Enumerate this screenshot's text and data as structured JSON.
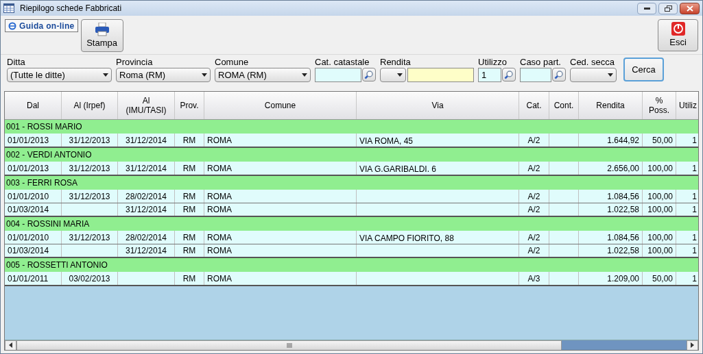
{
  "window": {
    "title": "Riepilogo schede Fabbricati"
  },
  "toolbar": {
    "help_link": "Guida on-line",
    "print_button": "Stampa",
    "exit_button": "Esci"
  },
  "filters": [
    {
      "kind": "select",
      "label": "Ditta",
      "value": "(Tutte le ditte)"
    },
    {
      "kind": "select",
      "label": "Provincia",
      "value": "Roma (RM)"
    },
    {
      "kind": "select",
      "label": "Comune",
      "value": "ROMA (RM)"
    },
    {
      "kind": "lookup",
      "label": "Cat. catastale"
    },
    {
      "kind": "range",
      "label": "Rendita"
    },
    {
      "kind": "lookup",
      "label": "Utilizzo",
      "value": "1"
    },
    {
      "kind": "lookup",
      "label": "Caso part."
    },
    {
      "kind": "select",
      "label": "Ced. secca"
    }
  ],
  "search_button": "Cerca",
  "table": {
    "columns": [
      "Dal",
      "Al (Irpef)",
      "Al (IMU/TASI)",
      "Prov.",
      "Comune",
      "Via",
      "Cat.",
      "Cont.",
      "Rendita",
      "% Poss.",
      "Utiliz"
    ],
    "groups": [
      {
        "title": "001 - ROSSI MARIO",
        "rows": [
          [
            "01/01/2013",
            "31/12/2013",
            "31/12/2014",
            "RM",
            "ROMA",
            "VIA ROMA, 45",
            "A/2",
            "",
            "1.644,92",
            "50,00",
            "1"
          ]
        ]
      },
      {
        "title": "002 - VERDI ANTONIO",
        "rows": [
          [
            "01/01/2013",
            "31/12/2013",
            "31/12/2014",
            "RM",
            "ROMA",
            "VIA G.GARIBALDI. 6",
            "A/2",
            "",
            "2.656,00",
            "100,00",
            "1"
          ]
        ]
      },
      {
        "title": "003 - FERRI ROSA",
        "rows": [
          [
            "01/01/2010",
            "31/12/2013",
            "28/02/2014",
            "RM",
            "ROMA",
            "",
            "A/2",
            "",
            "1.084,56",
            "100,00",
            "1"
          ],
          [
            "01/03/2014",
            "",
            "31/12/2014",
            "RM",
            "ROMA",
            "",
            "A/2",
            "",
            "1.022,58",
            "100,00",
            "1"
          ]
        ]
      },
      {
        "title": "004 - ROSSINI MARIA",
        "rows": [
          [
            "01/01/2010",
            "31/12/2013",
            "28/02/2014",
            "RM",
            "ROMA",
            "VIA CAMPO FIORITO, 88",
            "A/2",
            "",
            "1.084,56",
            "100,00",
            "1"
          ],
          [
            "01/03/2014",
            "",
            "31/12/2014",
            "RM",
            "ROMA",
            "",
            "A/2",
            "",
            "1.022,58",
            "100,00",
            "1"
          ]
        ]
      },
      {
        "title": "005 - ROSSETTI ANTONIO",
        "rows": [
          [
            "01/01/2011",
            "03/02/2013",
            "",
            "RM",
            "ROMA",
            "",
            "A/3",
            "",
            "1.209,00",
            "50,00",
            "1"
          ]
        ]
      }
    ]
  }
}
